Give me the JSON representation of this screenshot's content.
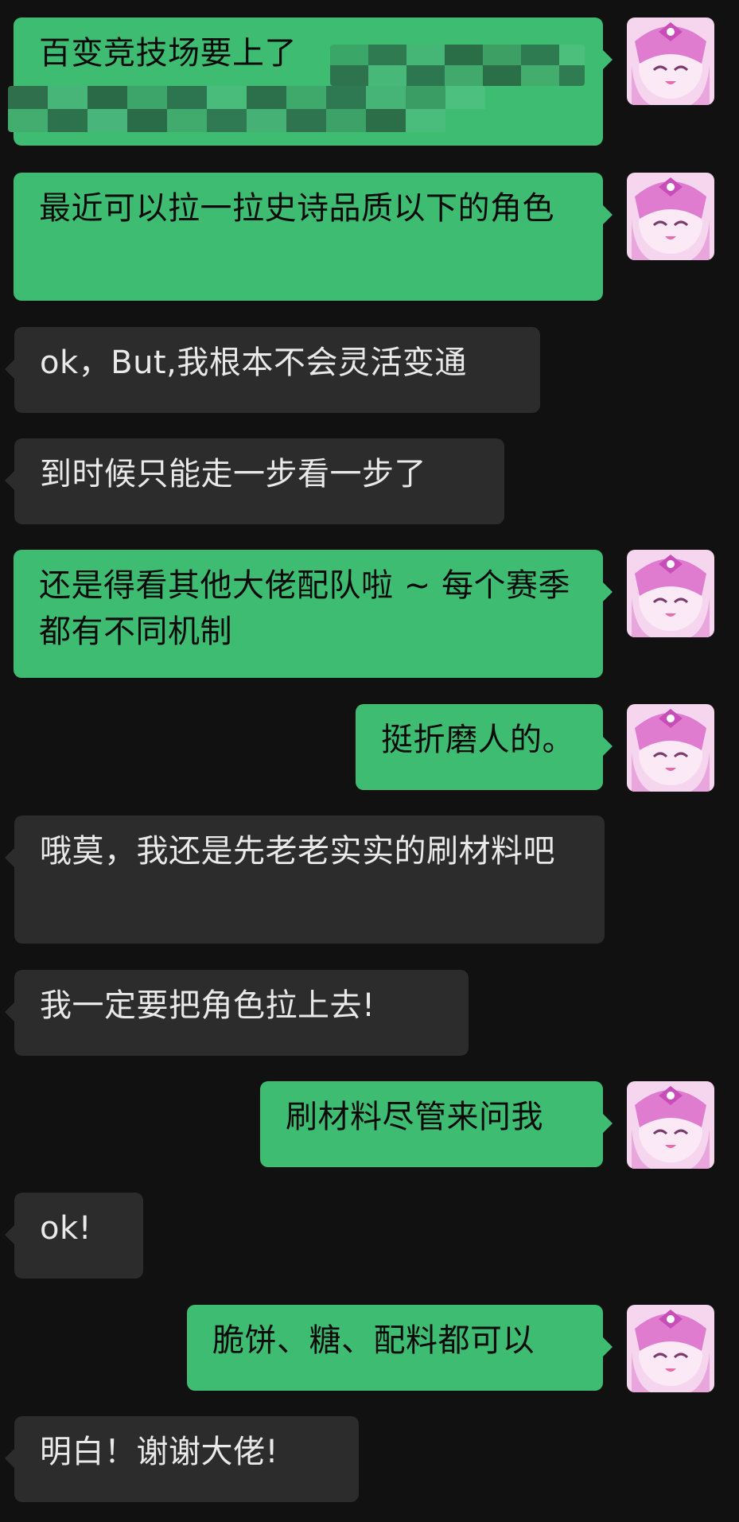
{
  "messages": [
    {
      "sender": "me",
      "text": "百变竞技场要上了",
      "redacted": true
    },
    {
      "sender": "me",
      "text": "最近可以拉一拉史诗品质以下的角色"
    },
    {
      "sender": "them",
      "text": "ok，But,我根本不会灵活变通"
    },
    {
      "sender": "them",
      "text": "到时候只能走一步看一步了"
    },
    {
      "sender": "me",
      "text": "还是得看其他大佬配队啦 ~ 每个赛季都有不同机制"
    },
    {
      "sender": "me",
      "text": "挺折磨人的。"
    },
    {
      "sender": "them",
      "text": "哦莫，我还是先老老实实的刷材料吧"
    },
    {
      "sender": "them",
      "text": "我一定要把角色拉上去!"
    },
    {
      "sender": "me",
      "text": "刷材料尽管来问我"
    },
    {
      "sender": "them",
      "text": "ok!"
    },
    {
      "sender": "me",
      "text": "脆饼、糖、配料都可以"
    },
    {
      "sender": "them",
      "text": "明白！谢谢大佬!"
    }
  ],
  "avatar": {
    "icon": "pink-anime-character-avatar-icon"
  },
  "colors": {
    "background": "#111111",
    "outgoing_bubble": "#3dbc72",
    "incoming_bubble": "#2c2c2c",
    "incoming_text": "#e9e9e9"
  }
}
